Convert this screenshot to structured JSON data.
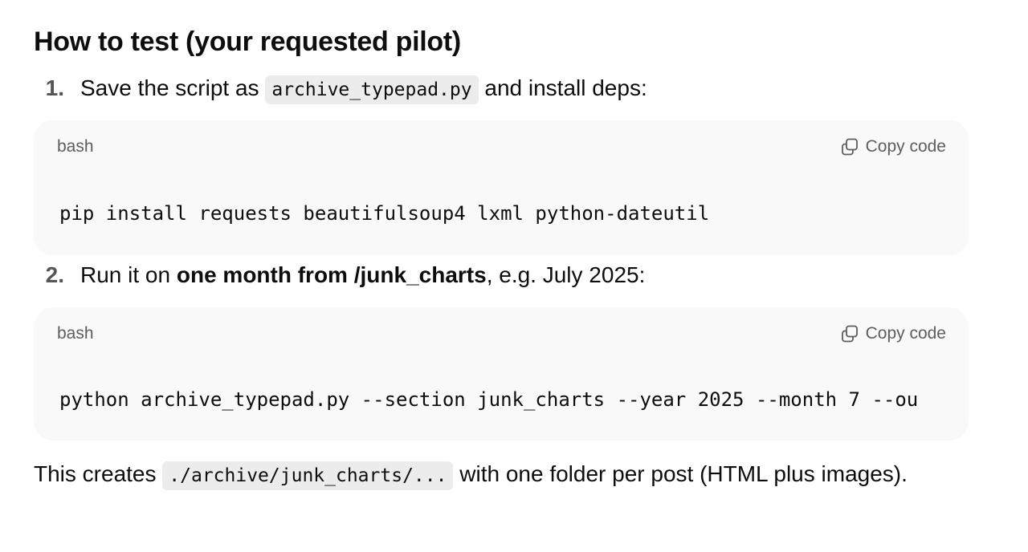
{
  "heading": "How to test (your requested pilot)",
  "steps": [
    {
      "number": "1.",
      "text_before": "Save the script as ",
      "code": "archive_typepad.py",
      "text_after": " and install deps:"
    },
    {
      "number": "2.",
      "text_before": "Run it on ",
      "bold": "one month from /junk_charts",
      "text_after": ", e.g. July 2025:"
    }
  ],
  "code_blocks": [
    {
      "language": "bash",
      "copy_label": "Copy code",
      "code": "pip install requests beautifulsoup4 lxml python-dateutil"
    },
    {
      "language": "bash",
      "copy_label": "Copy code",
      "code": "python archive_typepad.py --section junk_charts --year 2025 --month 7 --ou"
    }
  ],
  "closing": {
    "text_before": "This creates ",
    "code": "./archive/junk_charts/...",
    "text_after": " with one folder per post (HTML plus images)."
  },
  "icons": {
    "copy": "copy-icon"
  }
}
